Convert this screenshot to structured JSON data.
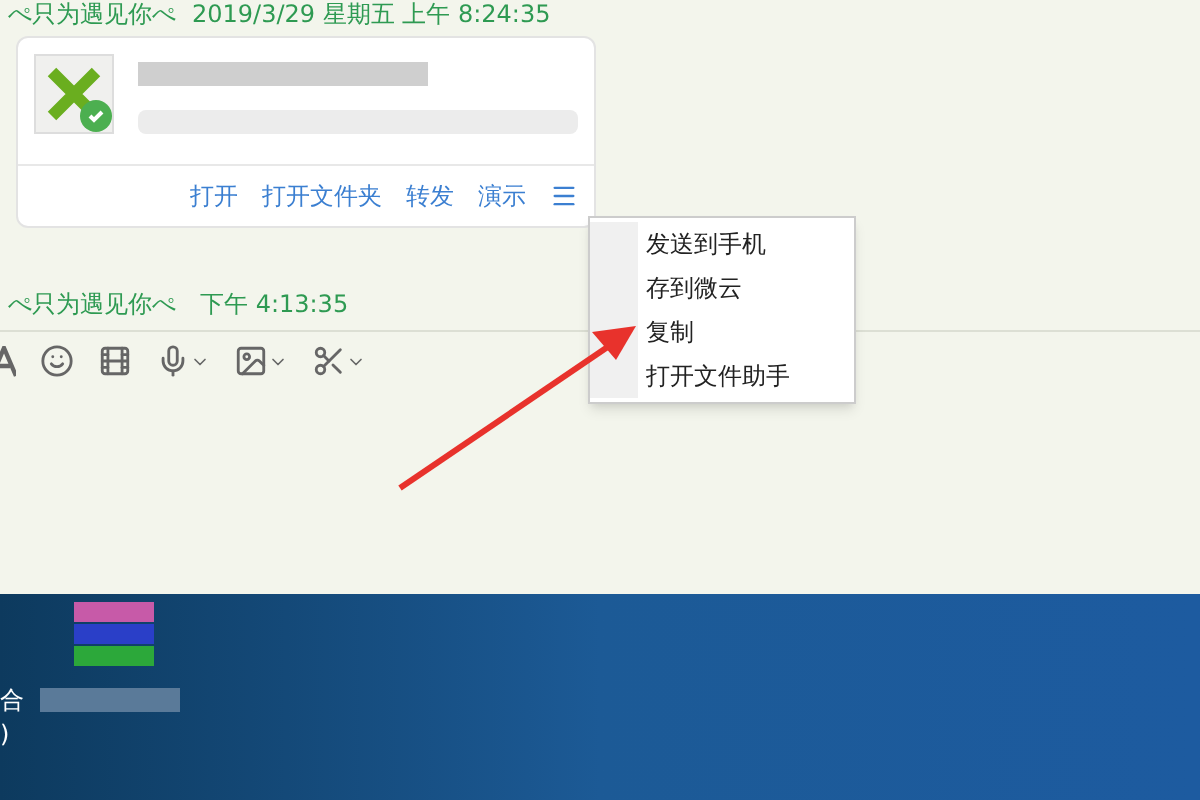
{
  "messages": [
    {
      "sender": "ぺ只为遇见你ぺ",
      "time": "2019/3/29 星期五 上午 8:24:35",
      "file_card": {
        "actions": [
          "打开",
          "打开文件夹",
          "转发",
          "演示"
        ]
      }
    },
    {
      "sender": "ぺ只为遇见你ぺ",
      "time": "下午 4:13:35"
    }
  ],
  "context_menu": {
    "items": [
      "发送到手机",
      "存到微云",
      "复制",
      "打开文件助手"
    ]
  },
  "desktop": {
    "labels": [
      "合",
      ")"
    ]
  }
}
